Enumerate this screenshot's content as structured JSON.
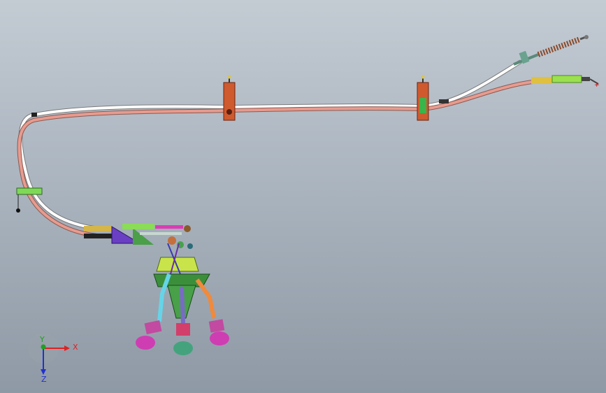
{
  "triad": {
    "x_label": "X",
    "y_label": "Y",
    "z_label": "Z"
  },
  "colors": {
    "bg_top": "#c3cbd3",
    "bg_bottom": "#8e99a5",
    "cable_white": "#ffffff",
    "cable_red": "#e79b8f",
    "clamp_orange": "#cf5a2e",
    "shifter_base": "#3f8f3a",
    "axis_x": "#e02020",
    "axis_y": "#20a020",
    "axis_z": "#2030d0"
  }
}
